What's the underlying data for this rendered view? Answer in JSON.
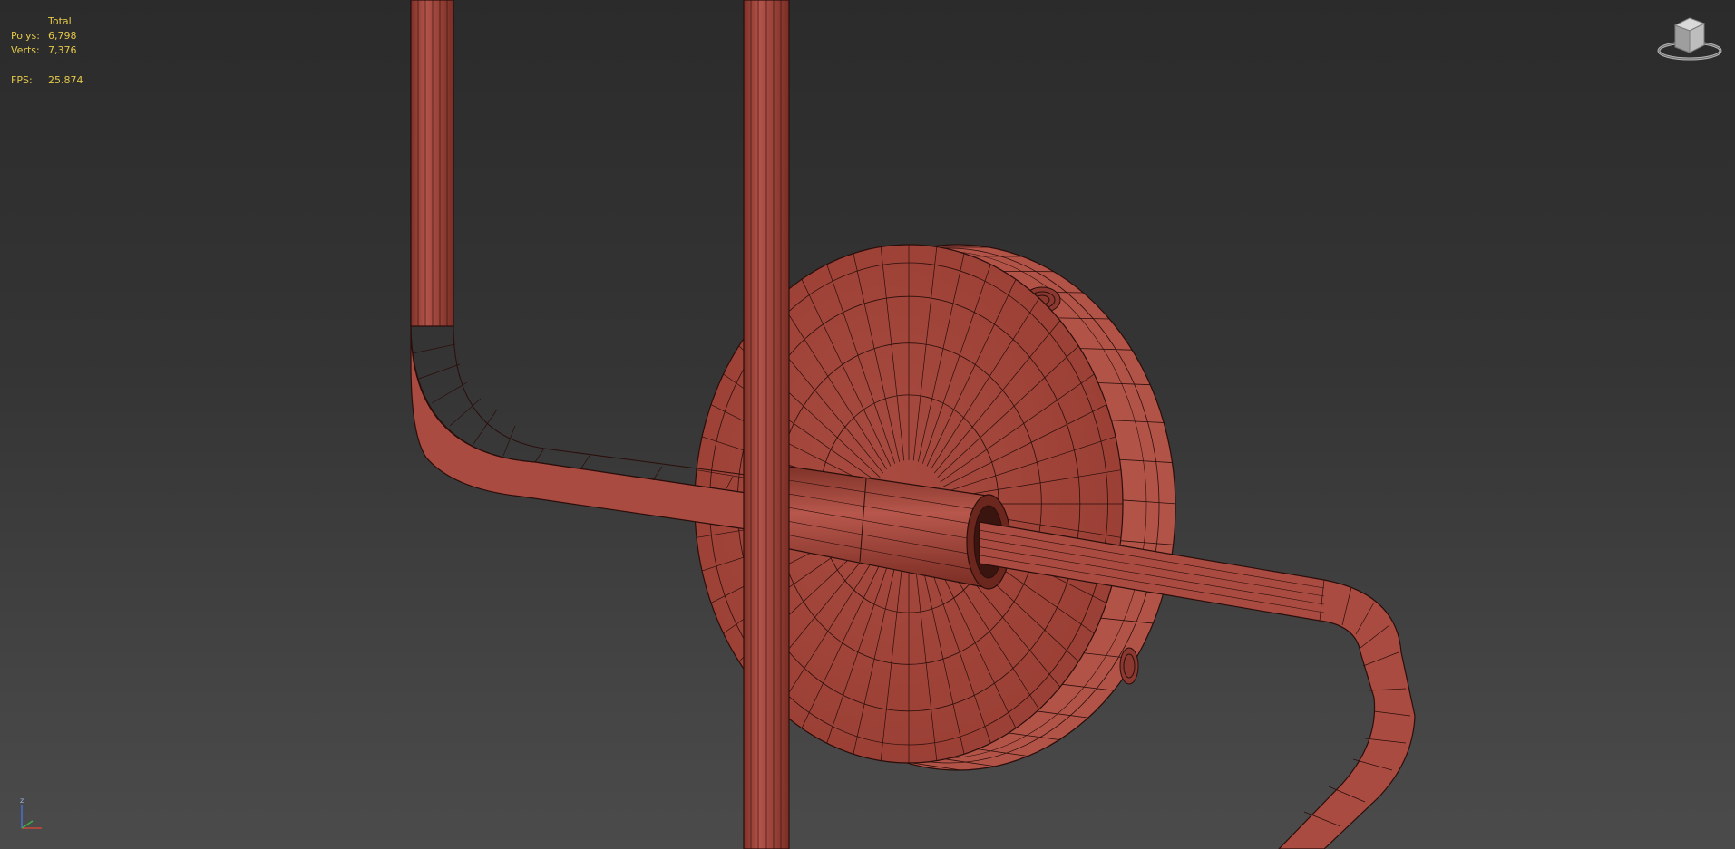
{
  "viewport": {
    "background_top": "#2b2b2b",
    "background_bottom": "#4b4b4b",
    "mesh_color": "#a8473c",
    "wire_color": "#2a0e0b"
  },
  "stats": {
    "header": "Total",
    "polys_label": "Polys:",
    "polys_value": "6,798",
    "verts_label": "Verts:",
    "verts_value": "7,376",
    "fps_label": "FPS:",
    "fps_value": "25.874",
    "text_color": "#e3c84a"
  },
  "gizmo": {
    "z_label": "z",
    "icon": "viewcube-icon",
    "axis_icon": "axis-tripod-icon"
  }
}
